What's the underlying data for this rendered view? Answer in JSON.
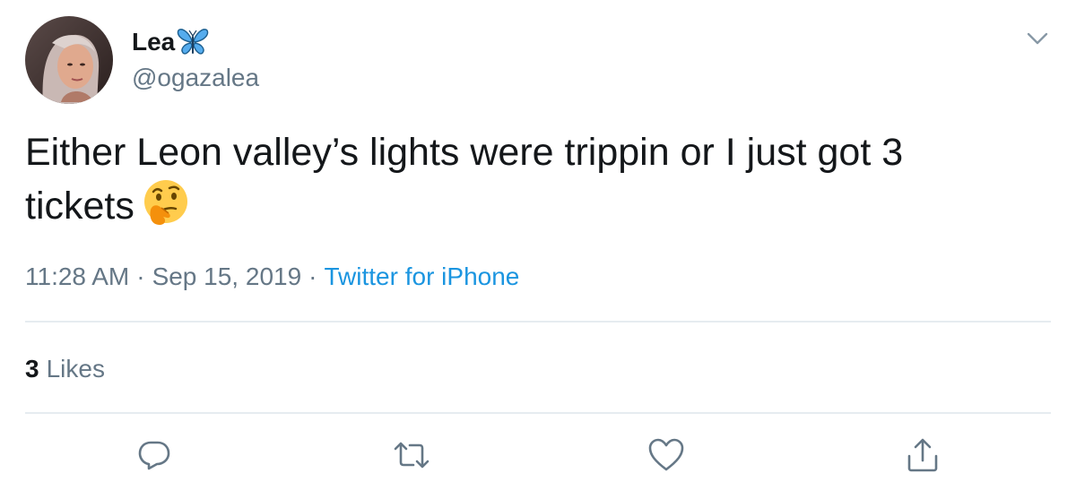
{
  "author": {
    "display_name": "Lea",
    "handle": "@ogazalea",
    "name_emoji": "butterfly-icon"
  },
  "tweet": {
    "text": "Either Leon valley’s lights were trippin or I just got 3 tickets",
    "emoji": "thinking-face-icon",
    "time": "11:28 AM",
    "date": "Sep 15, 2019",
    "separator": "·",
    "source": "Twitter for iPhone"
  },
  "stats": {
    "likes_count": "3",
    "likes_label": "Likes"
  },
  "actions": {
    "reply": "reply-icon",
    "retweet": "retweet-icon",
    "like": "heart-icon",
    "share": "share-icon"
  },
  "colors": {
    "text": "#14171a",
    "secondary": "#657786",
    "link": "#1b95e0",
    "divider": "#e6ecf0",
    "butterfly": "#55acee"
  }
}
